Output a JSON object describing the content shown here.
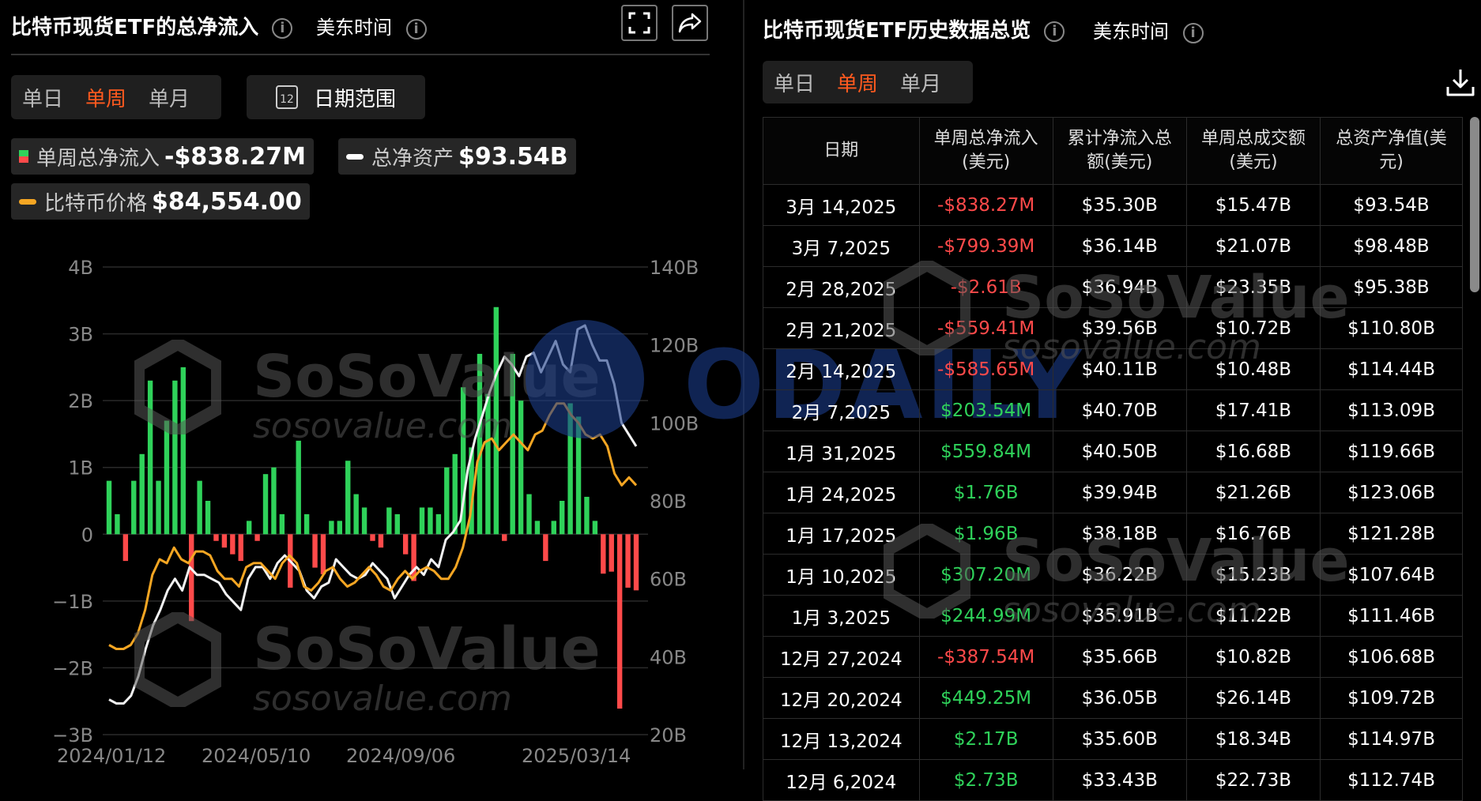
{
  "left": {
    "title": "比特币现货ETF的总净流入",
    "timezone": "美东时间",
    "period_tabs": [
      "单日",
      "单周",
      "单月"
    ],
    "active_tab": "单周",
    "date_range_label": "日期范围",
    "calendar_day": "12",
    "legend": {
      "flow_label": "单周总净流入",
      "flow_value": "-$838.27M",
      "assets_label": "总净资产",
      "assets_value": "$93.54B",
      "price_label": "比特币价格",
      "price_value": "$84,554.00"
    }
  },
  "right": {
    "title": "比特币现货ETF历史数据总览",
    "timezone": "美东时间",
    "period_tabs": [
      "单日",
      "单周",
      "单月"
    ],
    "active_tab": "单周",
    "headers": [
      "日期",
      "单周总净流入\n(美元)",
      "累计净流入总\n额(美元)",
      "单周总成交额\n(美元)",
      "总资产净值(美\n元)"
    ],
    "rows": [
      [
        "3月 14,2025",
        "-$838.27M",
        "$35.30B",
        "$15.47B",
        "$93.54B"
      ],
      [
        "3月 7,2025",
        "-$799.39M",
        "$36.14B",
        "$21.07B",
        "$98.48B"
      ],
      [
        "2月 28,2025",
        "-$2.61B",
        "$36.94B",
        "$23.35B",
        "$95.38B"
      ],
      [
        "2月 21,2025",
        "-$559.41M",
        "$39.56B",
        "$10.72B",
        "$110.80B"
      ],
      [
        "2月 14,2025",
        "-$585.65M",
        "$40.11B",
        "$10.48B",
        "$114.44B"
      ],
      [
        "2月 7,2025",
        "$203.54M",
        "$40.70B",
        "$17.41B",
        "$113.09B"
      ],
      [
        "1月 31,2025",
        "$559.84M",
        "$40.50B",
        "$16.68B",
        "$119.66B"
      ],
      [
        "1月 24,2025",
        "$1.76B",
        "$39.94B",
        "$21.26B",
        "$123.06B"
      ],
      [
        "1月 17,2025",
        "$1.96B",
        "$38.18B",
        "$16.76B",
        "$121.28B"
      ],
      [
        "1月 10,2025",
        "$307.20M",
        "$36.22B",
        "$15.23B",
        "$107.64B"
      ],
      [
        "1月 3,2025",
        "$244.99M",
        "$35.91B",
        "$11.22B",
        "$111.46B"
      ],
      [
        "12月 27,2024",
        "-$387.54M",
        "$35.66B",
        "$10.82B",
        "$106.68B"
      ],
      [
        "12月 20,2024",
        "$449.25M",
        "$36.05B",
        "$26.14B",
        "$109.72B"
      ],
      [
        "12月 13,2024",
        "$2.17B",
        "$35.60B",
        "$18.34B",
        "$114.97B"
      ],
      [
        "12月 6,2024",
        "$2.73B",
        "$33.43B",
        "$22.73B",
        "$112.74B"
      ]
    ]
  },
  "watermarks": {
    "brand": "SoSoValue",
    "site": "sosovalue.com",
    "odaily": "ODAILY"
  },
  "colors": {
    "bg": "#000000",
    "positive": "#2fd25a",
    "negative": "#ff4a4a",
    "accent": "#ff5a1f",
    "assets_line": "#f2f2f2",
    "price_line": "#f5a623"
  },
  "chart_data": {
    "type": "bar",
    "x_tick_labels": [
      "2024/01/12",
      "2024/05/10",
      "2024/09/06",
      "2025/03/14"
    ],
    "left_axis": {
      "unit": "USD",
      "ticks": [
        "4B",
        "3B",
        "2B",
        "1B",
        "0",
        "−1B",
        "−2B",
        "−3B"
      ],
      "ylim": [
        -3,
        4
      ]
    },
    "right_axis": {
      "unit": "USD",
      "ticks": [
        "140B",
        "120B",
        "100B",
        "80B",
        "60B",
        "40B",
        "20B"
      ],
      "ylim": [
        20,
        140
      ]
    },
    "grid": true,
    "series": [
      {
        "name": "单周总净流入",
        "type": "bar",
        "unit": "B",
        "values": [
          0.8,
          0.3,
          -0.4,
          0.8,
          1.2,
          2.3,
          0.8,
          1.7,
          2.3,
          2.5,
          -1.3,
          0.8,
          0.5,
          -0.1,
          -0.2,
          -0.3,
          -0.4,
          0.2,
          -0.1,
          0.9,
          1.0,
          0.3,
          -0.8,
          1.4,
          0.3,
          -0.5,
          -0.6,
          0.2,
          0.2,
          1.1,
          0.6,
          0.4,
          -0.1,
          -0.2,
          0.4,
          0.3,
          -0.3,
          -0.7,
          0.4,
          0.4,
          0.3,
          1.0,
          1.2,
          2.2,
          1.3,
          2.7,
          2.1,
          3.4,
          -0.1,
          2.7,
          2.0,
          0.6,
          0.2,
          -0.4,
          0.2,
          0.5,
          1.96,
          1.76,
          0.56,
          0.2,
          -0.59,
          -0.56,
          -2.61,
          -0.8,
          -0.84
        ]
      },
      {
        "name": "总净资产",
        "type": "line",
        "unit": "B",
        "values": [
          29,
          28,
          28,
          30,
          35,
          42,
          48,
          52,
          57,
          60,
          57,
          63,
          61,
          61,
          60,
          59,
          56,
          54,
          52,
          60,
          63,
          63,
          60,
          64,
          66,
          64,
          62,
          57,
          55,
          58,
          59,
          65,
          63,
          61,
          60,
          61,
          64,
          62,
          60,
          55,
          58,
          61,
          63,
          61,
          65,
          63,
          70,
          72,
          75,
          88,
          96,
          102,
          108,
          113,
          117,
          115,
          112,
          117,
          118,
          113,
          117,
          121,
          115,
          113,
          124,
          125,
          120,
          116,
          116,
          110,
          100,
          97,
          94
        ]
      },
      {
        "name": "比特币价格",
        "type": "line",
        "unit": "k USD",
        "values": [
          43,
          42,
          42,
          43,
          46,
          52,
          61,
          65,
          64,
          68,
          65,
          64,
          67,
          67,
          66,
          62,
          60,
          60,
          58,
          63,
          64,
          64,
          62,
          60,
          64,
          66,
          64,
          58,
          57,
          59,
          62,
          63,
          60,
          58,
          59,
          61,
          63,
          61,
          58,
          57,
          60,
          62,
          60,
          62,
          63,
          62,
          60,
          60,
          63,
          68,
          76,
          90,
          95,
          96,
          93,
          95,
          97,
          95,
          93,
          97,
          98,
          102,
          105,
          105,
          102,
          100,
          97,
          96,
          97,
          94,
          87,
          84,
          86,
          84
        ]
      }
    ]
  }
}
